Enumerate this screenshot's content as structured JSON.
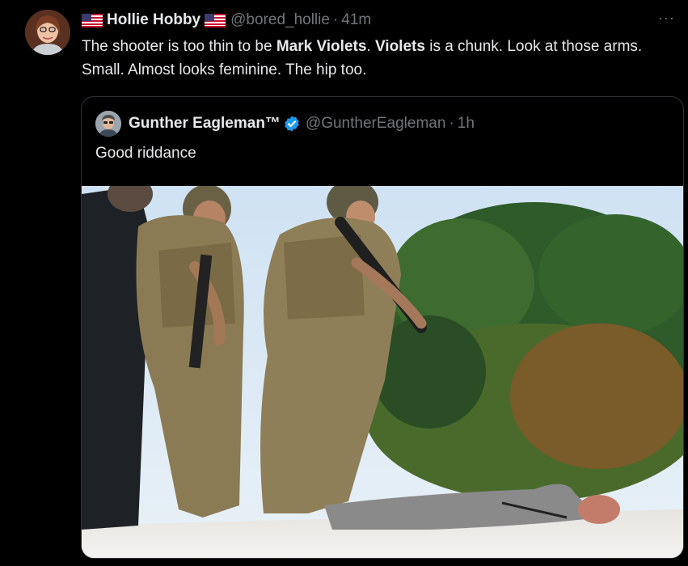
{
  "tweet": {
    "author_name": "Hollie Hobby",
    "author_handle": "@bored_hollie",
    "separator": "·",
    "time": "41m",
    "more_label": "···",
    "text_1": "The shooter is too thin to be ",
    "bold_1": "Mark Violets",
    "text_2": ". ",
    "bold_2": "Violets",
    "text_3": " is a chunk. Look at those arms. Small. Almost looks feminine. The hip too."
  },
  "quote": {
    "author_name": "Gunther Eagleman™",
    "author_handle": "@GuntherEagleman",
    "separator": "·",
    "time": "1h",
    "text": "Good riddance",
    "image_icon": "photo-of-armed-officers-on-rooftop"
  },
  "icons": {
    "flag": "us-flag-icon",
    "verified": "verified-badge-icon",
    "verified_color": "#1d9bf0"
  }
}
